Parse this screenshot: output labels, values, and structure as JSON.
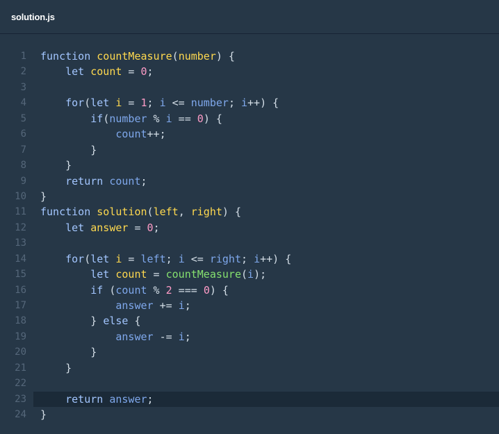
{
  "file": {
    "name": "solution.js"
  },
  "editor": {
    "active_line": 23,
    "colors": {
      "background": "#263747",
      "active_line": "#1b2a38",
      "line_number": "#55677a",
      "keyword": "#a3c6ff",
      "function": "#ffd94f",
      "variable": "#7fa8ec",
      "number": "#ff9cc7",
      "call": "#86e16f",
      "plain": "#d5dfe8"
    },
    "lines": [
      {
        "n": "1",
        "t": [
          [
            "k",
            "function "
          ],
          [
            "f",
            "countMeasure"
          ],
          [
            "p",
            "("
          ],
          [
            "f",
            "number"
          ],
          [
            "p",
            ") {"
          ]
        ]
      },
      {
        "n": "2",
        "t": [
          [
            "p",
            "    "
          ],
          [
            "k",
            "let "
          ],
          [
            "f",
            "count"
          ],
          [
            "p",
            " = "
          ],
          [
            "n",
            "0"
          ],
          [
            "p",
            ";"
          ]
        ]
      },
      {
        "n": "3",
        "t": []
      },
      {
        "n": "4",
        "t": [
          [
            "p",
            "    "
          ],
          [
            "k",
            "for"
          ],
          [
            "p",
            "("
          ],
          [
            "k",
            "let "
          ],
          [
            "f",
            "i"
          ],
          [
            "p",
            " = "
          ],
          [
            "n",
            "1"
          ],
          [
            "p",
            "; "
          ],
          [
            "v",
            "i"
          ],
          [
            "p",
            " <= "
          ],
          [
            "v",
            "number"
          ],
          [
            "p",
            "; "
          ],
          [
            "v",
            "i"
          ],
          [
            "p",
            "++) {"
          ]
        ]
      },
      {
        "n": "5",
        "t": [
          [
            "p",
            "        "
          ],
          [
            "k",
            "if"
          ],
          [
            "p",
            "("
          ],
          [
            "v",
            "number"
          ],
          [
            "p",
            " % "
          ],
          [
            "v",
            "i"
          ],
          [
            "p",
            " == "
          ],
          [
            "n",
            "0"
          ],
          [
            "p",
            ") {"
          ]
        ]
      },
      {
        "n": "6",
        "t": [
          [
            "p",
            "            "
          ],
          [
            "v",
            "count"
          ],
          [
            "p",
            "++;"
          ]
        ]
      },
      {
        "n": "7",
        "t": [
          [
            "p",
            "        }"
          ]
        ]
      },
      {
        "n": "8",
        "t": [
          [
            "p",
            "    }"
          ]
        ]
      },
      {
        "n": "9",
        "t": [
          [
            "p",
            "    "
          ],
          [
            "k",
            "return "
          ],
          [
            "v",
            "count"
          ],
          [
            "p",
            ";"
          ]
        ]
      },
      {
        "n": "10",
        "t": [
          [
            "p",
            "}"
          ]
        ]
      },
      {
        "n": "11",
        "t": [
          [
            "k",
            "function "
          ],
          [
            "f",
            "solution"
          ],
          [
            "p",
            "("
          ],
          [
            "f",
            "left"
          ],
          [
            "p",
            ", "
          ],
          [
            "f",
            "right"
          ],
          [
            "p",
            ") {"
          ]
        ]
      },
      {
        "n": "12",
        "t": [
          [
            "p",
            "    "
          ],
          [
            "k",
            "let "
          ],
          [
            "f",
            "answer"
          ],
          [
            "p",
            " = "
          ],
          [
            "n",
            "0"
          ],
          [
            "p",
            ";"
          ]
        ]
      },
      {
        "n": "13",
        "t": []
      },
      {
        "n": "14",
        "t": [
          [
            "p",
            "    "
          ],
          [
            "k",
            "for"
          ],
          [
            "p",
            "("
          ],
          [
            "k",
            "let "
          ],
          [
            "f",
            "i"
          ],
          [
            "p",
            " = "
          ],
          [
            "v",
            "left"
          ],
          [
            "p",
            "; "
          ],
          [
            "v",
            "i"
          ],
          [
            "p",
            " <= "
          ],
          [
            "v",
            "right"
          ],
          [
            "p",
            "; "
          ],
          [
            "v",
            "i"
          ],
          [
            "p",
            "++) {"
          ]
        ]
      },
      {
        "n": "15",
        "t": [
          [
            "p",
            "        "
          ],
          [
            "k",
            "let "
          ],
          [
            "f",
            "count"
          ],
          [
            "p",
            " = "
          ],
          [
            "c",
            "countMeasure"
          ],
          [
            "p",
            "("
          ],
          [
            "v",
            "i"
          ],
          [
            "p",
            ");"
          ]
        ]
      },
      {
        "n": "16",
        "t": [
          [
            "p",
            "        "
          ],
          [
            "k",
            "if "
          ],
          [
            "p",
            "("
          ],
          [
            "v",
            "count"
          ],
          [
            "p",
            " % "
          ],
          [
            "n",
            "2"
          ],
          [
            "p",
            " === "
          ],
          [
            "n",
            "0"
          ],
          [
            "p",
            ") {"
          ]
        ]
      },
      {
        "n": "17",
        "t": [
          [
            "p",
            "            "
          ],
          [
            "v",
            "answer"
          ],
          [
            "p",
            " += "
          ],
          [
            "v",
            "i"
          ],
          [
            "p",
            ";"
          ]
        ]
      },
      {
        "n": "18",
        "t": [
          [
            "p",
            "        } "
          ],
          [
            "k",
            "else"
          ],
          [
            "p",
            " {"
          ]
        ]
      },
      {
        "n": "19",
        "t": [
          [
            "p",
            "            "
          ],
          [
            "v",
            "answer"
          ],
          [
            "p",
            " -= "
          ],
          [
            "v",
            "i"
          ],
          [
            "p",
            ";"
          ]
        ]
      },
      {
        "n": "20",
        "t": [
          [
            "p",
            "        }"
          ]
        ]
      },
      {
        "n": "21",
        "t": [
          [
            "p",
            "    }"
          ]
        ]
      },
      {
        "n": "22",
        "t": []
      },
      {
        "n": "23",
        "t": [
          [
            "p",
            "    "
          ],
          [
            "k",
            "return "
          ],
          [
            "v",
            "answer"
          ],
          [
            "p",
            ";"
          ]
        ]
      },
      {
        "n": "24",
        "t": [
          [
            "p",
            "}"
          ]
        ]
      }
    ]
  }
}
